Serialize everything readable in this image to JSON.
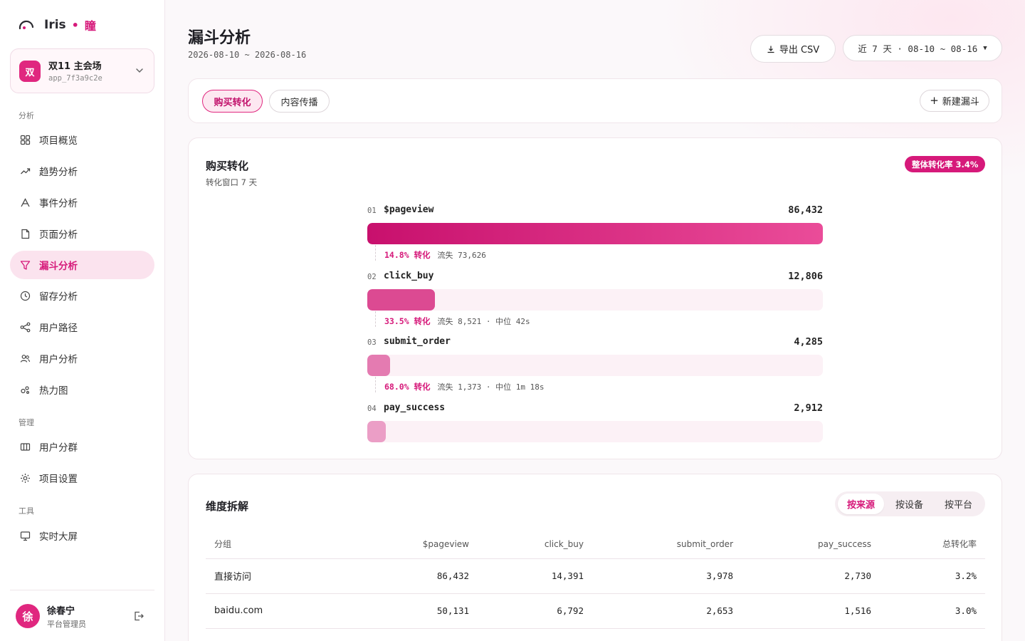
{
  "brand": {
    "name": "Iris",
    "sub": "瞳",
    "accent": "#d6197a"
  },
  "project": {
    "avatar": "双",
    "name": "双11 主会场",
    "id": "app_7f3a9c2e"
  },
  "nav": {
    "section_analysis": "分析",
    "section_manage": "管理",
    "section_tools": "工具",
    "items": [
      {
        "label": "项目概览",
        "icon": "grid-icon"
      },
      {
        "label": "趋势分析",
        "icon": "trend-icon"
      },
      {
        "label": "事件分析",
        "icon": "event-icon"
      },
      {
        "label": "页面分析",
        "icon": "page-icon"
      },
      {
        "label": "漏斗分析",
        "icon": "funnel-icon",
        "active": true
      },
      {
        "label": "留存分析",
        "icon": "clock-icon"
      },
      {
        "label": "用户路径",
        "icon": "share-icon"
      },
      {
        "label": "用户分析",
        "icon": "users-icon"
      },
      {
        "label": "热力图",
        "icon": "heatmap-icon"
      },
      {
        "label": "用户分群",
        "icon": "segment-icon"
      },
      {
        "label": "项目设置",
        "icon": "gear-icon"
      },
      {
        "label": "实时大屏",
        "icon": "monitor-icon"
      }
    ]
  },
  "user": {
    "avatar": "徐",
    "name": "徐春宁",
    "role": "平台管理员"
  },
  "header": {
    "title": "漏斗分析",
    "range": "2026-08-10 ~ 2026-08-16",
    "export_label": "导出 CSV",
    "date_label": "近 7 天 · 08-10 ~ 08-16"
  },
  "tabs": {
    "items": [
      "购买转化",
      "内容传播"
    ],
    "new_label": "新建漏斗"
  },
  "funnel": {
    "title": "购买转化",
    "subtitle": "转化窗口 7 天",
    "badge": "整体转化率 3.4%",
    "steps": [
      {
        "idx": "01",
        "name": "$pageview",
        "value": "86,432",
        "count": 86432
      },
      {
        "idx": "02",
        "name": "click_buy",
        "value": "12,806",
        "count": 12806
      },
      {
        "idx": "03",
        "name": "submit_order",
        "value": "4,285",
        "count": 4285
      },
      {
        "idx": "04",
        "name": "pay_success",
        "value": "2,912",
        "count": 2912
      }
    ],
    "conversions": [
      {
        "rate": "14.8% 转化",
        "meta": "流失 73,626"
      },
      {
        "rate": "33.5% 转化",
        "meta": "流失 8,521 · 中位 42s"
      },
      {
        "rate": "68.0% 转化",
        "meta": "流失 1,373 · 中位 1m 18s"
      }
    ]
  },
  "dimension": {
    "title": "维度拆解",
    "segments": [
      "按来源",
      "按设备",
      "按平台"
    ],
    "headers": [
      "分组",
      "$pageview",
      "click_buy",
      "submit_order",
      "pay_success",
      "总转化率"
    ],
    "rows": [
      [
        "直接访问",
        "86,432",
        "14,391",
        "3,978",
        "2,730",
        "3.2%"
      ],
      [
        "baidu.com",
        "50,131",
        "6,792",
        "2,653",
        "1,516",
        "3.0%"
      ]
    ]
  }
}
